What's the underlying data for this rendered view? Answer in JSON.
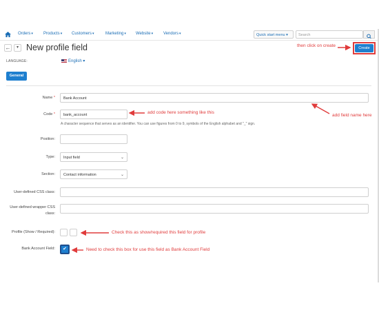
{
  "nav": {
    "home_icon": "home-icon",
    "items": [
      {
        "label": "Orders",
        "caret": "▾"
      },
      {
        "label": "Products",
        "caret": "▾"
      },
      {
        "label": "Customers",
        "caret": "▾"
      },
      {
        "label": "Marketing",
        "caret": "▾"
      },
      {
        "label": "Website",
        "caret": "▾"
      },
      {
        "label": "Vendors",
        "caret": "▾"
      }
    ],
    "quick_start": "Quick start menu ▾",
    "search_placeholder": "Search",
    "search_icon": "search-icon"
  },
  "header": {
    "back_glyph": "←",
    "dropdown_glyph": "▾",
    "title": "New profile field",
    "create_label": "Create"
  },
  "language": {
    "label": "LANGUAGE:",
    "value": "English ▾"
  },
  "tabs": [
    {
      "label": "General"
    }
  ],
  "form": {
    "name": {
      "label": "Name",
      "required": "*",
      "value": "Bank Account"
    },
    "code": {
      "label": "Code",
      "required": "*",
      "value": "bank_account",
      "hint": "A character sequence that serves as an identifier. You can use figures from 0 to 9, symbols of the English alphabet and \"_\" sign."
    },
    "position": {
      "label": "Position:",
      "value": ""
    },
    "type": {
      "label": "Type:",
      "value": "Input field"
    },
    "section": {
      "label": "Section:",
      "value": "Contact information"
    },
    "css_class": {
      "label": "User-defined CSS class:",
      "value": ""
    },
    "wrapper_css_class": {
      "label_line1": "User-defined wrapper CSS",
      "label_line2": "class:",
      "value": ""
    },
    "profile": {
      "label": "Profile (Show / Required):",
      "show": false,
      "required": false
    },
    "bank_account_field": {
      "label": "Bank Account Field:",
      "checked": true,
      "check_glyph": "✔"
    }
  },
  "annotations": {
    "create": "then click on create",
    "field_name": "add field name here",
    "code": "add code here something like this",
    "profile": "Check this as show/required this field for profile",
    "bank_account": "Need to check this box for use this field as Bank Account Field",
    "color": "#e03b3b"
  },
  "colors": {
    "accent": "#1e7fcf",
    "link": "#1a6db5",
    "annotation": "#e03b3b"
  }
}
